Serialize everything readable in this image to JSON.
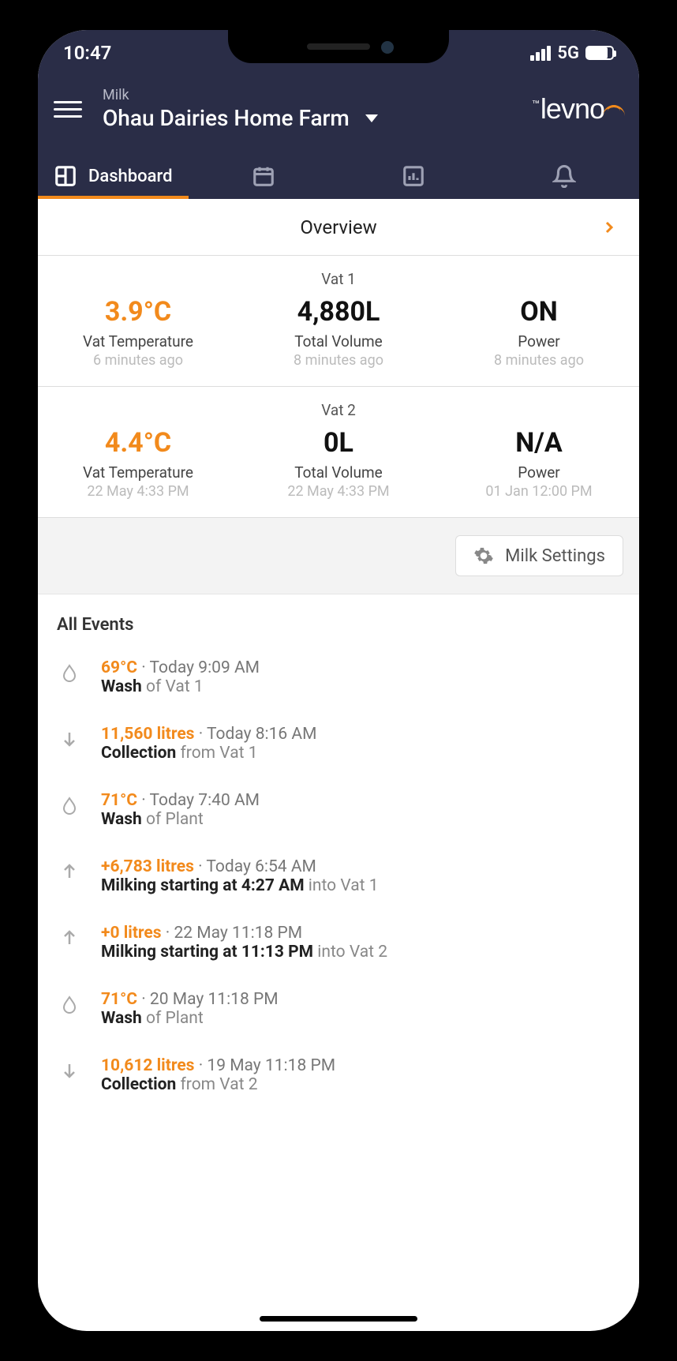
{
  "status": {
    "time": "10:47",
    "network": "5G"
  },
  "header": {
    "category": "Milk",
    "farm_name": "Ohau Dairies Home Farm",
    "logo_text": "levno"
  },
  "tabs": {
    "dashboard_label": "Dashboard"
  },
  "overview": {
    "label": "Overview"
  },
  "vats": [
    {
      "name": "Vat 1",
      "temp_value": "3.9°C",
      "temp_label": "Vat Temperature",
      "temp_time": "6 minutes ago",
      "vol_value": "4,880L",
      "vol_label": "Total Volume",
      "vol_time": "8 minutes ago",
      "power_value": "ON",
      "power_label": "Power",
      "power_time": "8 minutes ago"
    },
    {
      "name": "Vat 2",
      "temp_value": "4.4°C",
      "temp_label": "Vat Temperature",
      "temp_time": "22 May 4:33 PM",
      "vol_value": "0L",
      "vol_label": "Total Volume",
      "vol_time": "22 May 4:33 PM",
      "power_value": "N/A",
      "power_label": "Power",
      "power_time": "01 Jan 12:00 PM"
    }
  ],
  "settings": {
    "button_label": "Milk Settings"
  },
  "events_title": "All Events",
  "events": [
    {
      "icon": "drop",
      "hl": "69°C",
      "rest1": " · Today 9:09 AM",
      "bold": "Wash",
      "rest2": " of Vat 1"
    },
    {
      "icon": "down",
      "hl": "11,560 litres",
      "rest1": " · Today 8:16 AM",
      "bold": "Collection",
      "rest2": " from Vat 1"
    },
    {
      "icon": "drop",
      "hl": "71°C",
      "rest1": " · Today 7:40 AM",
      "bold": "Wash",
      "rest2": " of Plant"
    },
    {
      "icon": "up",
      "hl": "+6,783 litres",
      "rest1": " · Today 6:54 AM",
      "bold": "Milking starting at 4:27 AM",
      "rest2": " into Vat 1"
    },
    {
      "icon": "up",
      "hl": "+0 litres",
      "rest1": " · 22 May 11:18 PM",
      "bold": "Milking starting at 11:13 PM",
      "rest2": " into Vat 2"
    },
    {
      "icon": "drop",
      "hl": "71°C",
      "rest1": " · 20 May 11:18 PM",
      "bold": "Wash",
      "rest2": " of Plant"
    },
    {
      "icon": "down",
      "hl": "10,612 litres",
      "rest1": " · 19 May 11:18 PM",
      "bold": "Collection",
      "rest2": " from Vat 2"
    }
  ]
}
